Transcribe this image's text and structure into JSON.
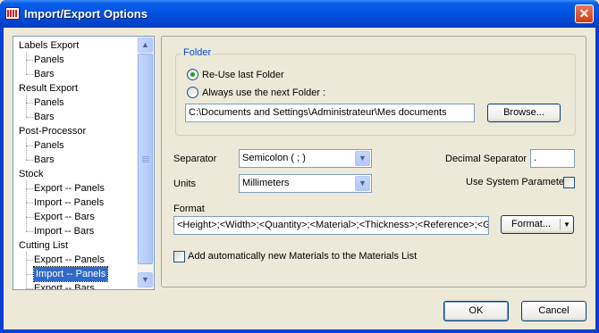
{
  "window": {
    "title": "Import/Export Options",
    "close_glyph": "✕"
  },
  "tree": {
    "items": [
      {
        "label": "Labels Export",
        "level": 0
      },
      {
        "label": "Panels",
        "level": 1
      },
      {
        "label": "Bars",
        "level": 1
      },
      {
        "label": "Result Export",
        "level": 0
      },
      {
        "label": "Panels",
        "level": 1
      },
      {
        "label": "Bars",
        "level": 1
      },
      {
        "label": "Post-Processor",
        "level": 0
      },
      {
        "label": "Panels",
        "level": 1
      },
      {
        "label": "Bars",
        "level": 1
      },
      {
        "label": "Stock",
        "level": 0
      },
      {
        "label": "Export -- Panels",
        "level": 1
      },
      {
        "label": "Import -- Panels",
        "level": 1
      },
      {
        "label": "Export -- Bars",
        "level": 1
      },
      {
        "label": "Import -- Bars",
        "level": 1
      },
      {
        "label": "Cutting List",
        "level": 0
      },
      {
        "label": "Export -- Panels",
        "level": 1
      },
      {
        "label": "Import -- Panels",
        "level": 1,
        "selected": true
      },
      {
        "label": "Export -- Bars",
        "level": 1
      }
    ],
    "scroll_up_glyph": "▲",
    "scroll_down_glyph": "▼"
  },
  "folder": {
    "group_label": "Folder",
    "reuse_label": "Re-Use last Folder",
    "always_label": "Always use the next Folder :",
    "selected_option": "reuse",
    "path_value": "C:\\Documents and Settings\\Administrateur\\Mes documents",
    "browse_label": "Browse..."
  },
  "settings": {
    "separator_label": "Separator",
    "separator_value": "Semicolon  ( ; )",
    "units_label": "Units",
    "units_value": "Millimeters",
    "decimal_label": "Decimal Separator",
    "decimal_value": ".",
    "system_param_label": "Use System Parameter",
    "system_param_checked": false,
    "format_label": "Format",
    "format_value": "<Height>;<Width>;<Quantity>;<Material>;<Thickness>;<Reference>;<Gra",
    "format_button_label": "Format...",
    "add_materials_label": "Add automatically new Materials to the Materials List",
    "add_materials_checked": false
  },
  "footer": {
    "ok_label": "OK",
    "cancel_label": "Cancel"
  },
  "icons": {
    "window": "app-icon",
    "dropdown": "chevron-down-icon",
    "scroll_up": "arrow-up-icon",
    "scroll_down": "arrow-down-icon"
  },
  "colors": {
    "titlebar": "#0054e3",
    "selection": "#316ac5",
    "group_label": "#0046d5"
  }
}
